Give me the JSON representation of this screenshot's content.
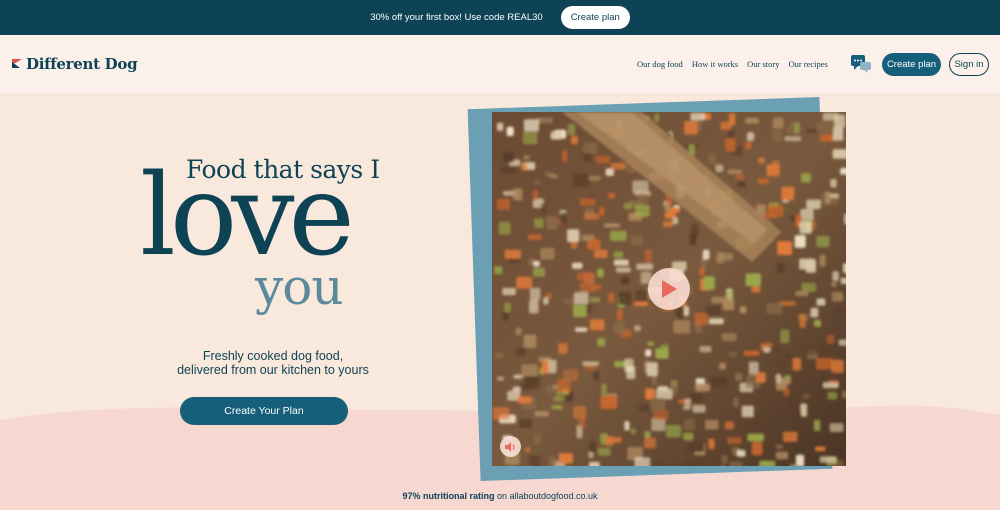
{
  "promo": {
    "text": "30% off your first box! Use code REAL30",
    "button": "Create plan"
  },
  "header": {
    "logo": "Different Dog",
    "nav": [
      "Our dog food",
      "How it works",
      "Our story",
      "Our recipes"
    ],
    "chat_icon": "chat-bubbles-icon",
    "create_plan": "Create plan",
    "sign_in": "Sign in"
  },
  "hero": {
    "line1": "Food that says I",
    "line2": "love",
    "line3": "you",
    "subtitle_1": "Freshly cooked dog food,",
    "subtitle_2": "delivered from our kitchen to yours",
    "cta": "Create Your Plan"
  },
  "video": {
    "play_icon": "play-icon",
    "sound_icon": "speaker-icon"
  },
  "rating": {
    "bold": "97% nutritional rating",
    "rest": "on allaboutdogfood.co.uk"
  },
  "colors": {
    "navy": "#0e4255",
    "accent": "#165f7b",
    "peach": "#f9e9dd",
    "pink": "#f6d8d1",
    "coral": "#e0554a"
  }
}
